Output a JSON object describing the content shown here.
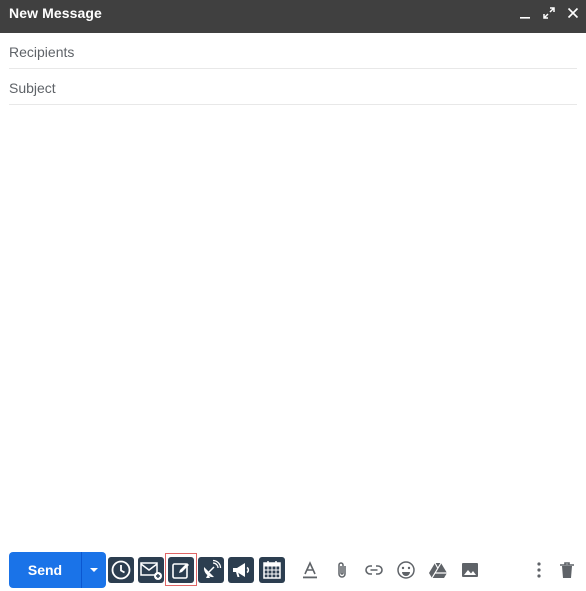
{
  "window": {
    "title": "New Message",
    "minimize_icon": "minimize-icon",
    "fullscreen_icon": "expand-icon",
    "close_icon": "close-icon"
  },
  "recipients": {
    "placeholder": "Recipients"
  },
  "subject": {
    "placeholder": "Subject"
  },
  "message_body": {
    "value": ""
  },
  "footer": {
    "send_label": "Send",
    "send_more_icon": "caret-down-icon",
    "extension_icons": [
      "clock-icon",
      "mail-add-icon",
      "edit-icon",
      "satellite-dish-icon",
      "megaphone-icon",
      "calendar-icon"
    ],
    "tool_icons": [
      "text-format-icon",
      "attach-icon",
      "link-icon",
      "emoji-icon",
      "drive-icon",
      "photo-icon"
    ],
    "more_icon": "more-vertical-icon",
    "trash_icon": "trash-icon"
  },
  "colors": {
    "titlebar": "#404040",
    "send_button": "#1a73e8",
    "extension_button": "#2c3e50",
    "highlight_border": "#e06666",
    "icon_gray": "#5f6368"
  }
}
